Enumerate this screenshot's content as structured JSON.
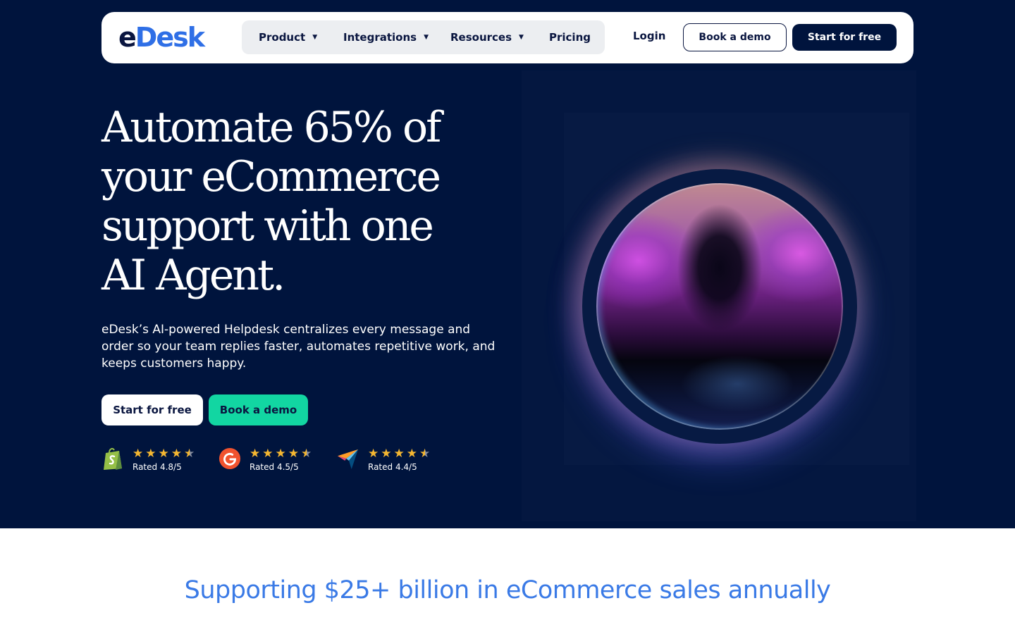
{
  "brand": {
    "logo_e": "e",
    "logo_desk": "Desk",
    "accent": "#2f6fe6",
    "navy": "#00143d",
    "teal": "#12d6a2"
  },
  "nav": {
    "menu": [
      {
        "label": "Product",
        "caret": "▼"
      },
      {
        "label": "Integrations",
        "caret": "▼"
      },
      {
        "label": "Resources",
        "caret": "▼"
      },
      {
        "label": "Pricing"
      }
    ],
    "login": "Login",
    "book_demo": "Book a demo",
    "start_free": "Start for free"
  },
  "hero": {
    "headline_lines": [
      "Automate 65% of",
      "your eCommerce",
      "support with one",
      "AI Agent."
    ],
    "subtext": "eDesk’s AI-powered Helpdesk centralizes every message and order so your team replies faster, automates repetitive work, and keeps customers happy.",
    "cta_start": "Start for free",
    "cta_demo": "Book a demo",
    "ratings": [
      {
        "source_icon": "shopify-icon",
        "rating": 4.8,
        "text": "Rated 4.8/5"
      },
      {
        "source_icon": "g2-icon",
        "rating": 4.5,
        "text": "Rated 4.5/5"
      },
      {
        "source_icon": "capterra-icon",
        "rating": 4.4,
        "text": "Rated 4.4/5"
      }
    ]
  },
  "band": {
    "title": "Supporting $25+ billion in eCommerce sales annually"
  }
}
